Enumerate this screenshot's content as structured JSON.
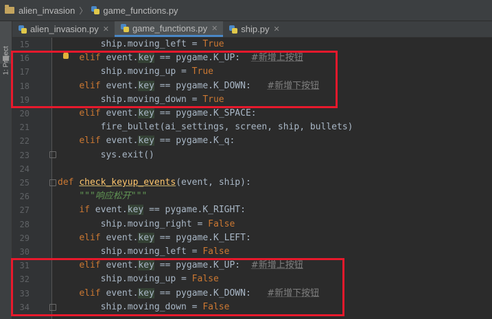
{
  "breadcrumb": {
    "project": "alien_invasion",
    "file": "game_functions.py"
  },
  "sidebar": {
    "project_label": "1: Project"
  },
  "tabs": [
    {
      "label": "alien_invasion.py",
      "active": false
    },
    {
      "label": "game_functions.py",
      "active": true
    },
    {
      "label": "ship.py",
      "active": false
    }
  ],
  "lines": [
    {
      "n": "15",
      "text": "        ship.moving_left = True"
    },
    {
      "n": "16",
      "text": "    elif event.key == pygame.K_UP:  #新增上按钮"
    },
    {
      "n": "17",
      "text": "        ship.moving_up = True"
    },
    {
      "n": "18",
      "text": "    elif event.key == pygame.K_DOWN:   #新增下按钮"
    },
    {
      "n": "19",
      "text": "        ship.moving_down = True"
    },
    {
      "n": "20",
      "text": "    elif event.key == pygame.K_SPACE:"
    },
    {
      "n": "21",
      "text": "        fire_bullet(ai_settings, screen, ship, bullets)"
    },
    {
      "n": "22",
      "text": "    elif event.key == pygame.K_q:"
    },
    {
      "n": "23",
      "text": "        sys.exit()"
    },
    {
      "n": "24",
      "text": ""
    },
    {
      "n": "25",
      "text": "def check_keyup_events(event, ship):"
    },
    {
      "n": "26",
      "text": "    \"\"\"响应松开\"\"\""
    },
    {
      "n": "27",
      "text": "    if event.key == pygame.K_RIGHT:"
    },
    {
      "n": "28",
      "text": "        ship.moving_right = False"
    },
    {
      "n": "29",
      "text": "    elif event.key == pygame.K_LEFT:"
    },
    {
      "n": "30",
      "text": "        ship.moving_left = False"
    },
    {
      "n": "31",
      "text": "    elif event.key == pygame.K_UP:  #新增上按钮"
    },
    {
      "n": "32",
      "text": "        ship.moving_up = False"
    },
    {
      "n": "33",
      "text": "    elif event.key == pygame.K_DOWN:   #新增下按钮"
    },
    {
      "n": "34",
      "text": "        ship.moving_down = False"
    }
  ],
  "colors": {
    "keyword": "#cc7832",
    "text": "#a9b7c6",
    "comment": "#808080",
    "docstring": "#629755",
    "function": "#ffc66d",
    "highlight_box": "#e8192c"
  }
}
